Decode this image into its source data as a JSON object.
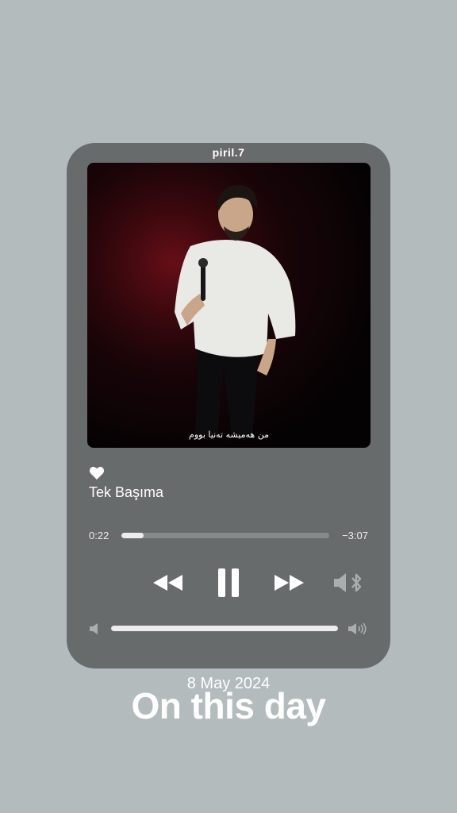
{
  "player": {
    "username": "piril.7",
    "subtitle": "من هەمیشە تەنیا بووم",
    "song_title": "Tek Başıma",
    "time_elapsed": "0:22",
    "time_remaining": "−3:07",
    "progress": 0.105,
    "volume": 1.0,
    "liked": true,
    "state": "playing"
  },
  "story": {
    "date": "8 May 2024",
    "headline": "On this day"
  },
  "icons": {
    "like": "heart-icon",
    "rewind": "rewind-icon",
    "pause": "pause-icon",
    "forward": "fast-forward-icon",
    "output": "speaker-bluetooth-icon",
    "volume_low": "speaker-low-icon",
    "volume_high": "speaker-high-icon"
  },
  "colors": {
    "background": "#b4bbbc",
    "card": "#676b6c",
    "track": "#858a8b",
    "fill": "#ececec",
    "text": "#ffffff"
  }
}
